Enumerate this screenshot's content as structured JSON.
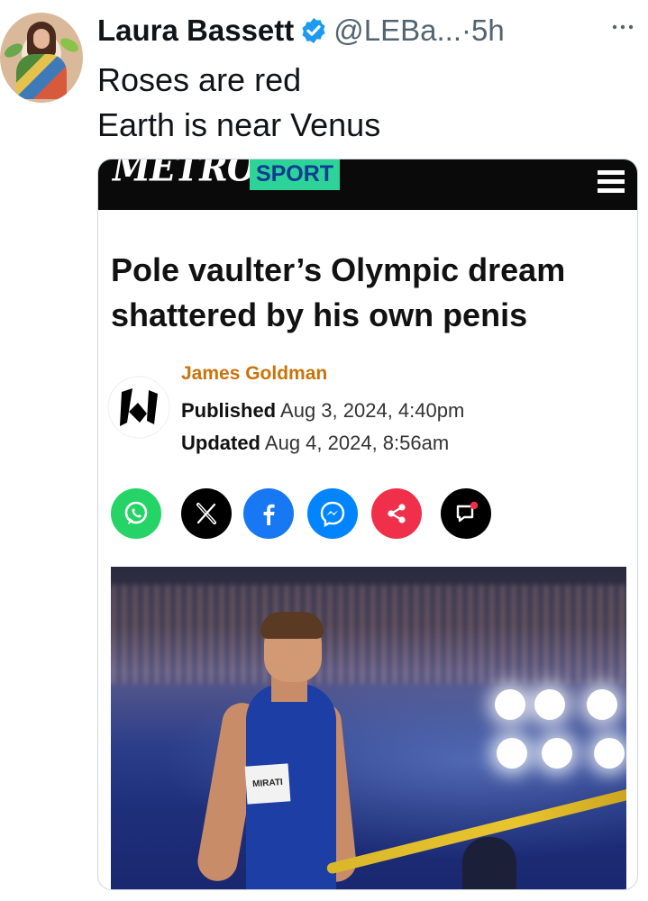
{
  "tweet": {
    "author_name": "Laura Bassett",
    "handle": "@LEBa...",
    "separator": "·",
    "time": "5h",
    "more_label": "···",
    "text_lines": [
      "Roses are red",
      "Earth is near Venus"
    ]
  },
  "card": {
    "logo": "METRO",
    "section": "SPORT",
    "headline": "Pole vaulter’s Olympic dream shattered by his own penis",
    "author": "James Goldman",
    "published_label": "Published",
    "published_value": "Aug 3, 2024, 4:40pm",
    "updated_label": "Updated",
    "updated_value": "Aug 4, 2024, 8:56am",
    "bib_text": "MIRATI",
    "share_buttons": [
      {
        "name": "whatsapp-icon",
        "color": "#25d366"
      },
      {
        "name": "x-icon",
        "color": "#000000"
      },
      {
        "name": "facebook-icon",
        "color": "#1877f2"
      },
      {
        "name": "messenger-icon",
        "color": "#0084ff"
      },
      {
        "name": "share-icon",
        "color": "#f0304a"
      },
      {
        "name": "comment-icon",
        "color": "#000000"
      }
    ]
  },
  "colors": {
    "verified": "#1d9bf0",
    "sport_bg": "#2ed39a",
    "author": "#c9730a"
  }
}
